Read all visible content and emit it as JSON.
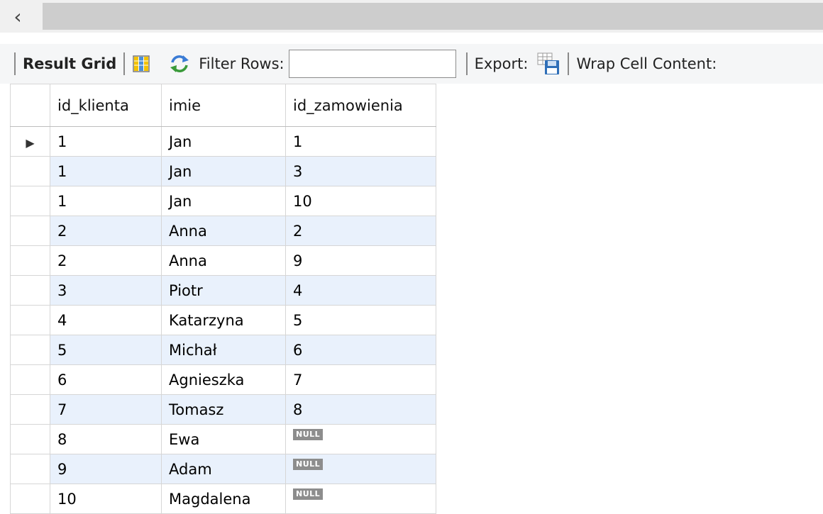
{
  "toolbar": {
    "result_grid_label": "Result Grid",
    "filter_rows_label": "Filter Rows:",
    "filter_rows_value": "",
    "export_label": "Export:",
    "wrap_cell_label": "Wrap Cell Content:"
  },
  "grid": {
    "columns": [
      "id_klienta",
      "imie",
      "id_zamowienia"
    ],
    "selected_row_index": 0,
    "rows": [
      {
        "id_klienta": "1",
        "imie": "Jan",
        "id_zamowienia": "1"
      },
      {
        "id_klienta": "1",
        "imie": "Jan",
        "id_zamowienia": "3"
      },
      {
        "id_klienta": "1",
        "imie": "Jan",
        "id_zamowienia": "10"
      },
      {
        "id_klienta": "2",
        "imie": "Anna",
        "id_zamowienia": "2"
      },
      {
        "id_klienta": "2",
        "imie": "Anna",
        "id_zamowienia": "9"
      },
      {
        "id_klienta": "3",
        "imie": "Piotr",
        "id_zamowienia": "4"
      },
      {
        "id_klienta": "4",
        "imie": "Katarzyna",
        "id_zamowienia": "5"
      },
      {
        "id_klienta": "5",
        "imie": "Michał",
        "id_zamowienia": "6"
      },
      {
        "id_klienta": "6",
        "imie": "Agnieszka",
        "id_zamowienia": "7"
      },
      {
        "id_klienta": "7",
        "imie": "Tomasz",
        "id_zamowienia": "8"
      },
      {
        "id_klienta": "8",
        "imie": "Ewa",
        "id_zamowienia": "NULL"
      },
      {
        "id_klienta": "9",
        "imie": "Adam",
        "id_zamowienia": "NULL"
      },
      {
        "id_klienta": "10",
        "imie": "Magdalena",
        "id_zamowienia": "NULL"
      }
    ]
  },
  "icons": {
    "scroll_left": "chevron-left-icon",
    "grid_view": "grid-columns-icon",
    "refresh": "refresh-icon",
    "export": "export-save-icon"
  },
  "colors": {
    "alt_row": "#e9f1fc",
    "toolbar_bg": "#f5f6f7",
    "null_badge": "#8d8d8d"
  }
}
